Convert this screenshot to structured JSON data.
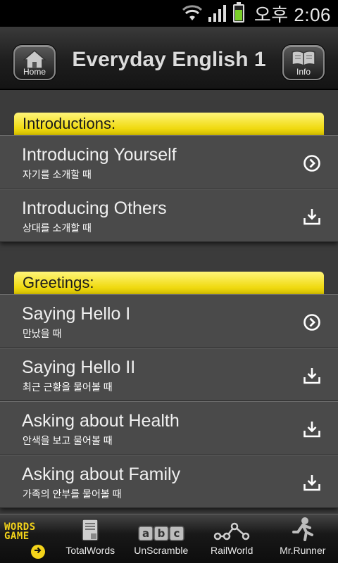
{
  "status": {
    "time": "오후 2:06"
  },
  "header": {
    "title": "Everyday English 1",
    "home_label": "Home",
    "info_label": "Info"
  },
  "sections": [
    {
      "title": "Introductions:",
      "items": [
        {
          "title": "Introducing Yourself",
          "subtitle": "자기를 소개할 때",
          "icon": "chevron-right-circle-icon"
        },
        {
          "title": "Introducing Others",
          "subtitle": "상대를 소개할 때",
          "icon": "download-icon"
        }
      ]
    },
    {
      "title": "Greetings:",
      "items": [
        {
          "title": "Saying Hello I",
          "subtitle": "만났을 때",
          "icon": "chevron-right-circle-icon"
        },
        {
          "title": "Saying Hello II",
          "subtitle": "최근 근황을 물어볼 때",
          "icon": "download-icon"
        },
        {
          "title": "Asking about Health",
          "subtitle": "안색을 보고 물어볼 때",
          "icon": "download-icon"
        },
        {
          "title": "Asking about Family",
          "subtitle": "가족의 안부를 물어볼 때",
          "icon": "download-icon"
        }
      ]
    }
  ],
  "tabbar": {
    "words_game_line1": "WORDS",
    "words_game_line2": "GAME",
    "tabs": [
      {
        "label": "TotalWords",
        "icon": "book-icon"
      },
      {
        "label": "UnScramble",
        "icon": "abc-blocks-icon"
      },
      {
        "label": "RailWorld",
        "icon": "rail-network-icon"
      },
      {
        "label": "Mr.Runner",
        "icon": "runner-icon"
      }
    ]
  },
  "colors": {
    "accent_yellow": "#f0da11",
    "background": "#3b3b3b",
    "row": "#4a4a4a"
  }
}
